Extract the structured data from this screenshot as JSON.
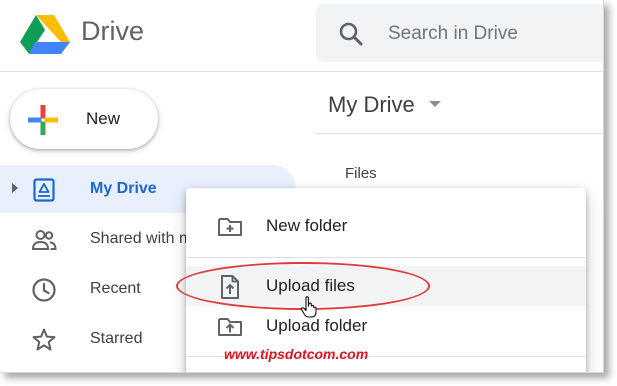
{
  "header": {
    "app_title": "Drive",
    "logo_icon": "google-drive-logo",
    "search": {
      "placeholder": "Search in Drive",
      "icon": "search-icon"
    }
  },
  "sidebar": {
    "new_button": {
      "label": "New",
      "icon": "multicolor-plus-icon"
    },
    "items": [
      {
        "label": "My Drive",
        "icon": "my-drive-icon",
        "active": true
      },
      {
        "label": "Shared with me",
        "icon": "shared-people-icon",
        "active": false
      },
      {
        "label": "Recent",
        "icon": "clock-icon",
        "active": false
      },
      {
        "label": "Starred",
        "icon": "star-icon",
        "active": false
      }
    ]
  },
  "main": {
    "title": "My Drive",
    "section_label": "Files"
  },
  "context_menu": {
    "items": [
      {
        "label": "New folder",
        "icon": "new-folder-icon"
      },
      {
        "label": "Upload files",
        "icon": "upload-file-icon",
        "highlighted": true
      },
      {
        "label": "Upload folder",
        "icon": "upload-folder-icon"
      }
    ]
  },
  "watermark": "www.tipsdotcom.com",
  "colors": {
    "accent_blue": "#1967d2",
    "active_bg": "#e8f0fe",
    "highlight_red": "#e03a3a",
    "watermark_red": "#e0141e"
  }
}
